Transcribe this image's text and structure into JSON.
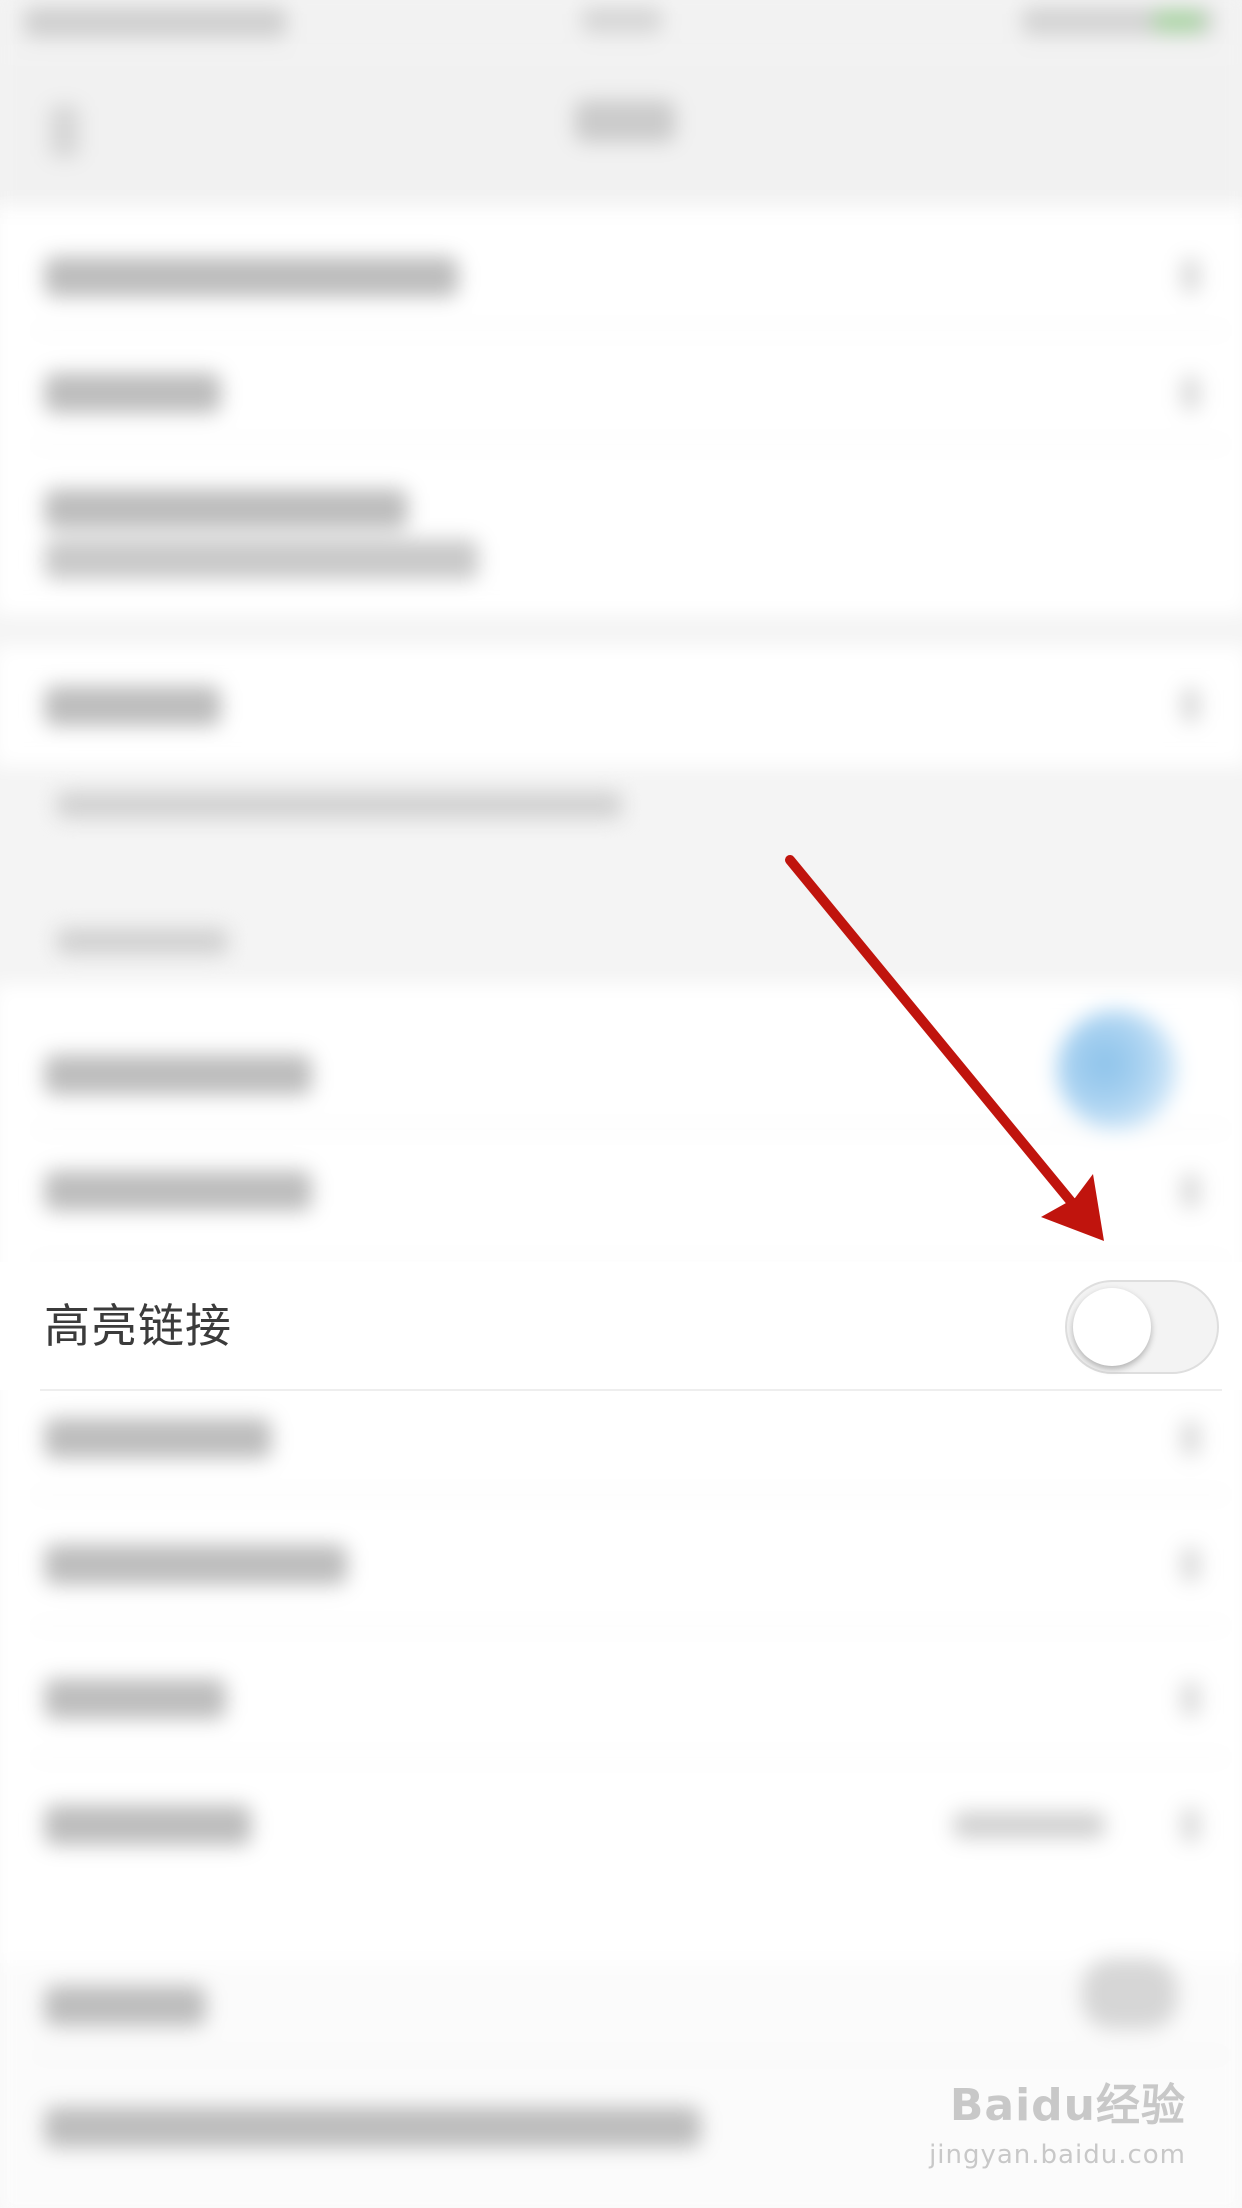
{
  "highlight_row": {
    "label": "高亮链接",
    "toggle_on": false
  },
  "watermark": {
    "main": "Baidu经验",
    "sub": "jingyan.baidu.com"
  },
  "colors": {
    "annotation_arrow": "#c0140d",
    "toggle_track": "#f3f3f3",
    "toggle_knob": "#ffffff",
    "background": "#f4f4f4"
  }
}
